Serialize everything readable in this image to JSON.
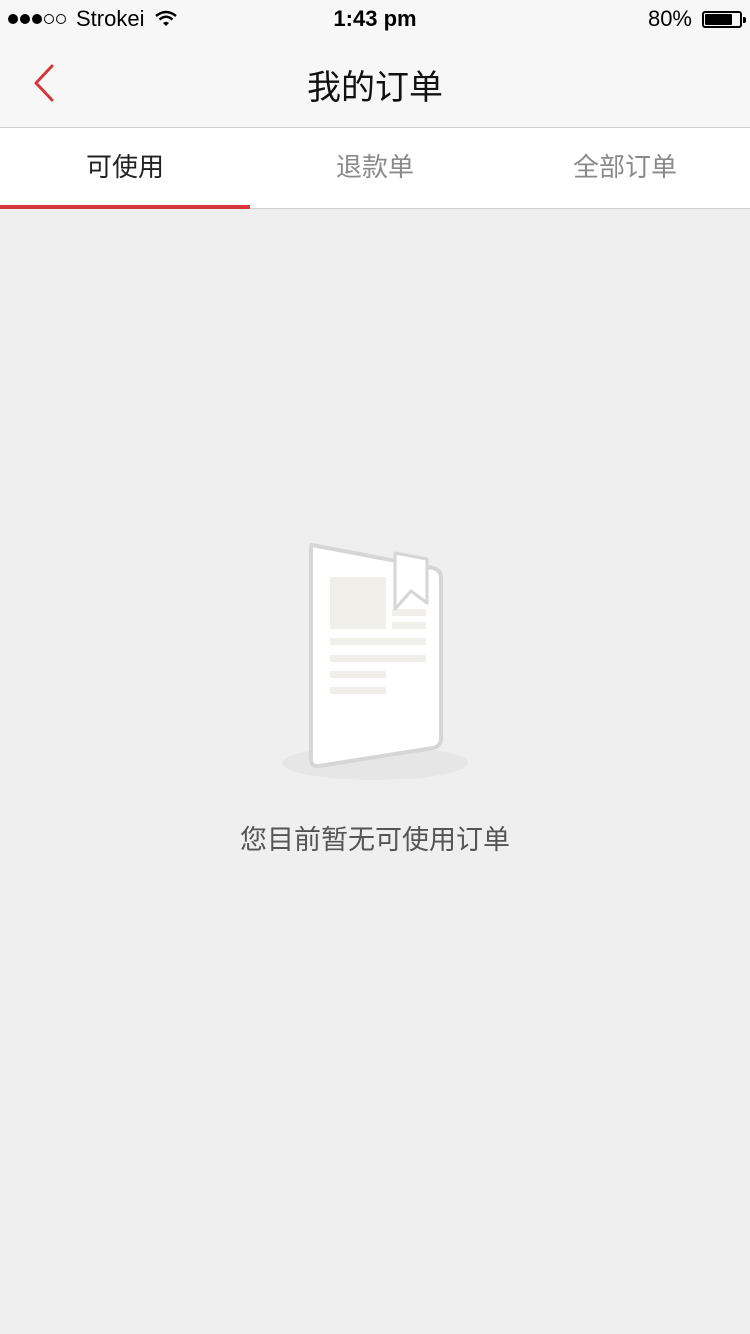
{
  "status_bar": {
    "carrier": "Strokei",
    "time": "1:43 pm",
    "battery_percent": "80%",
    "battery_level": 0.8,
    "signal_bars_filled": 3,
    "signal_bars_total": 5
  },
  "nav": {
    "title": "我的订单",
    "back_icon": "chevron-left-icon",
    "accent_color": "#d5373a"
  },
  "tabs": [
    {
      "label": "可使用",
      "active": true
    },
    {
      "label": "退款单",
      "active": false
    },
    {
      "label": "全部订单",
      "active": false
    }
  ],
  "empty_state": {
    "icon": "empty-book-icon",
    "message": "您目前暂无可使用订单"
  }
}
